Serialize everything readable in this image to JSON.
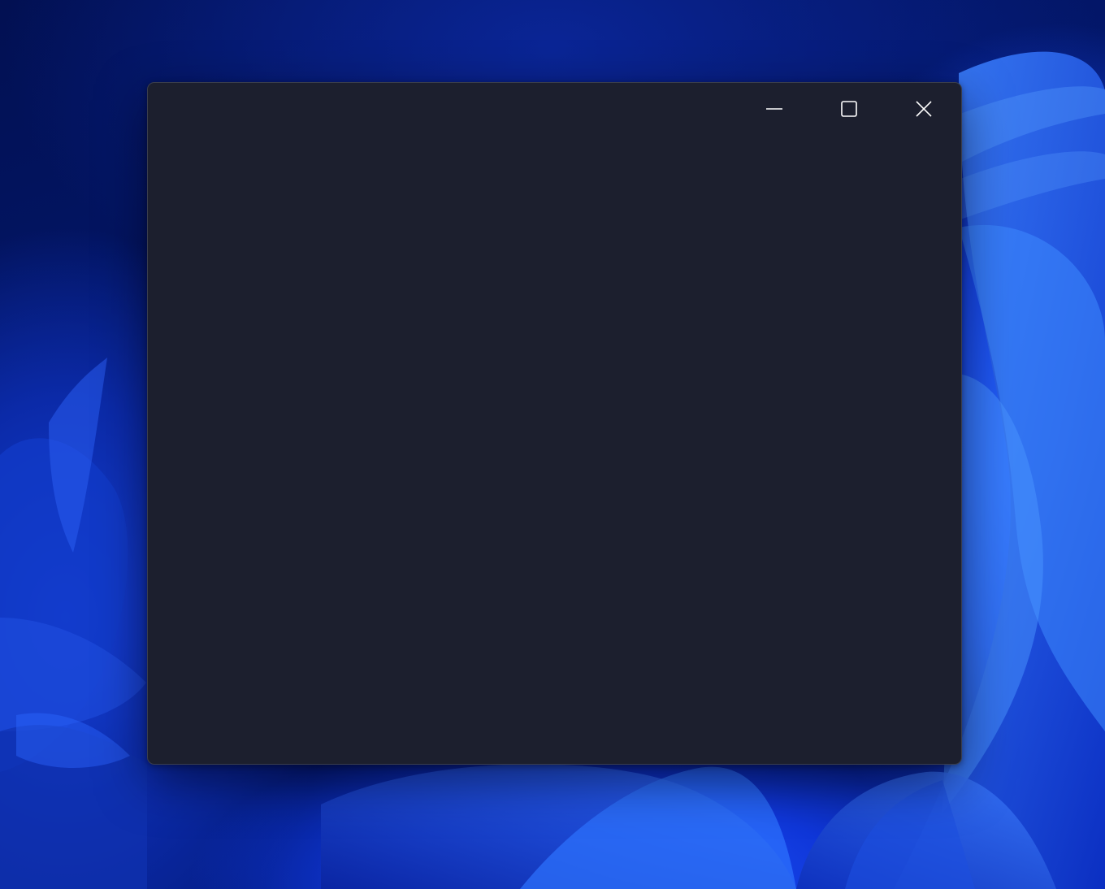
{
  "desktop": {
    "wallpaper": "windows-11-bloom-blue",
    "accent_color": "#1646e6"
  },
  "window": {
    "background_color": "#1c1f2e",
    "border_color": "#3a3e4d",
    "caption_buttons": [
      {
        "name": "minimize",
        "icon": "minimize-icon"
      },
      {
        "name": "maximize",
        "icon": "maximize-icon"
      },
      {
        "name": "close",
        "icon": "close-icon"
      }
    ]
  }
}
